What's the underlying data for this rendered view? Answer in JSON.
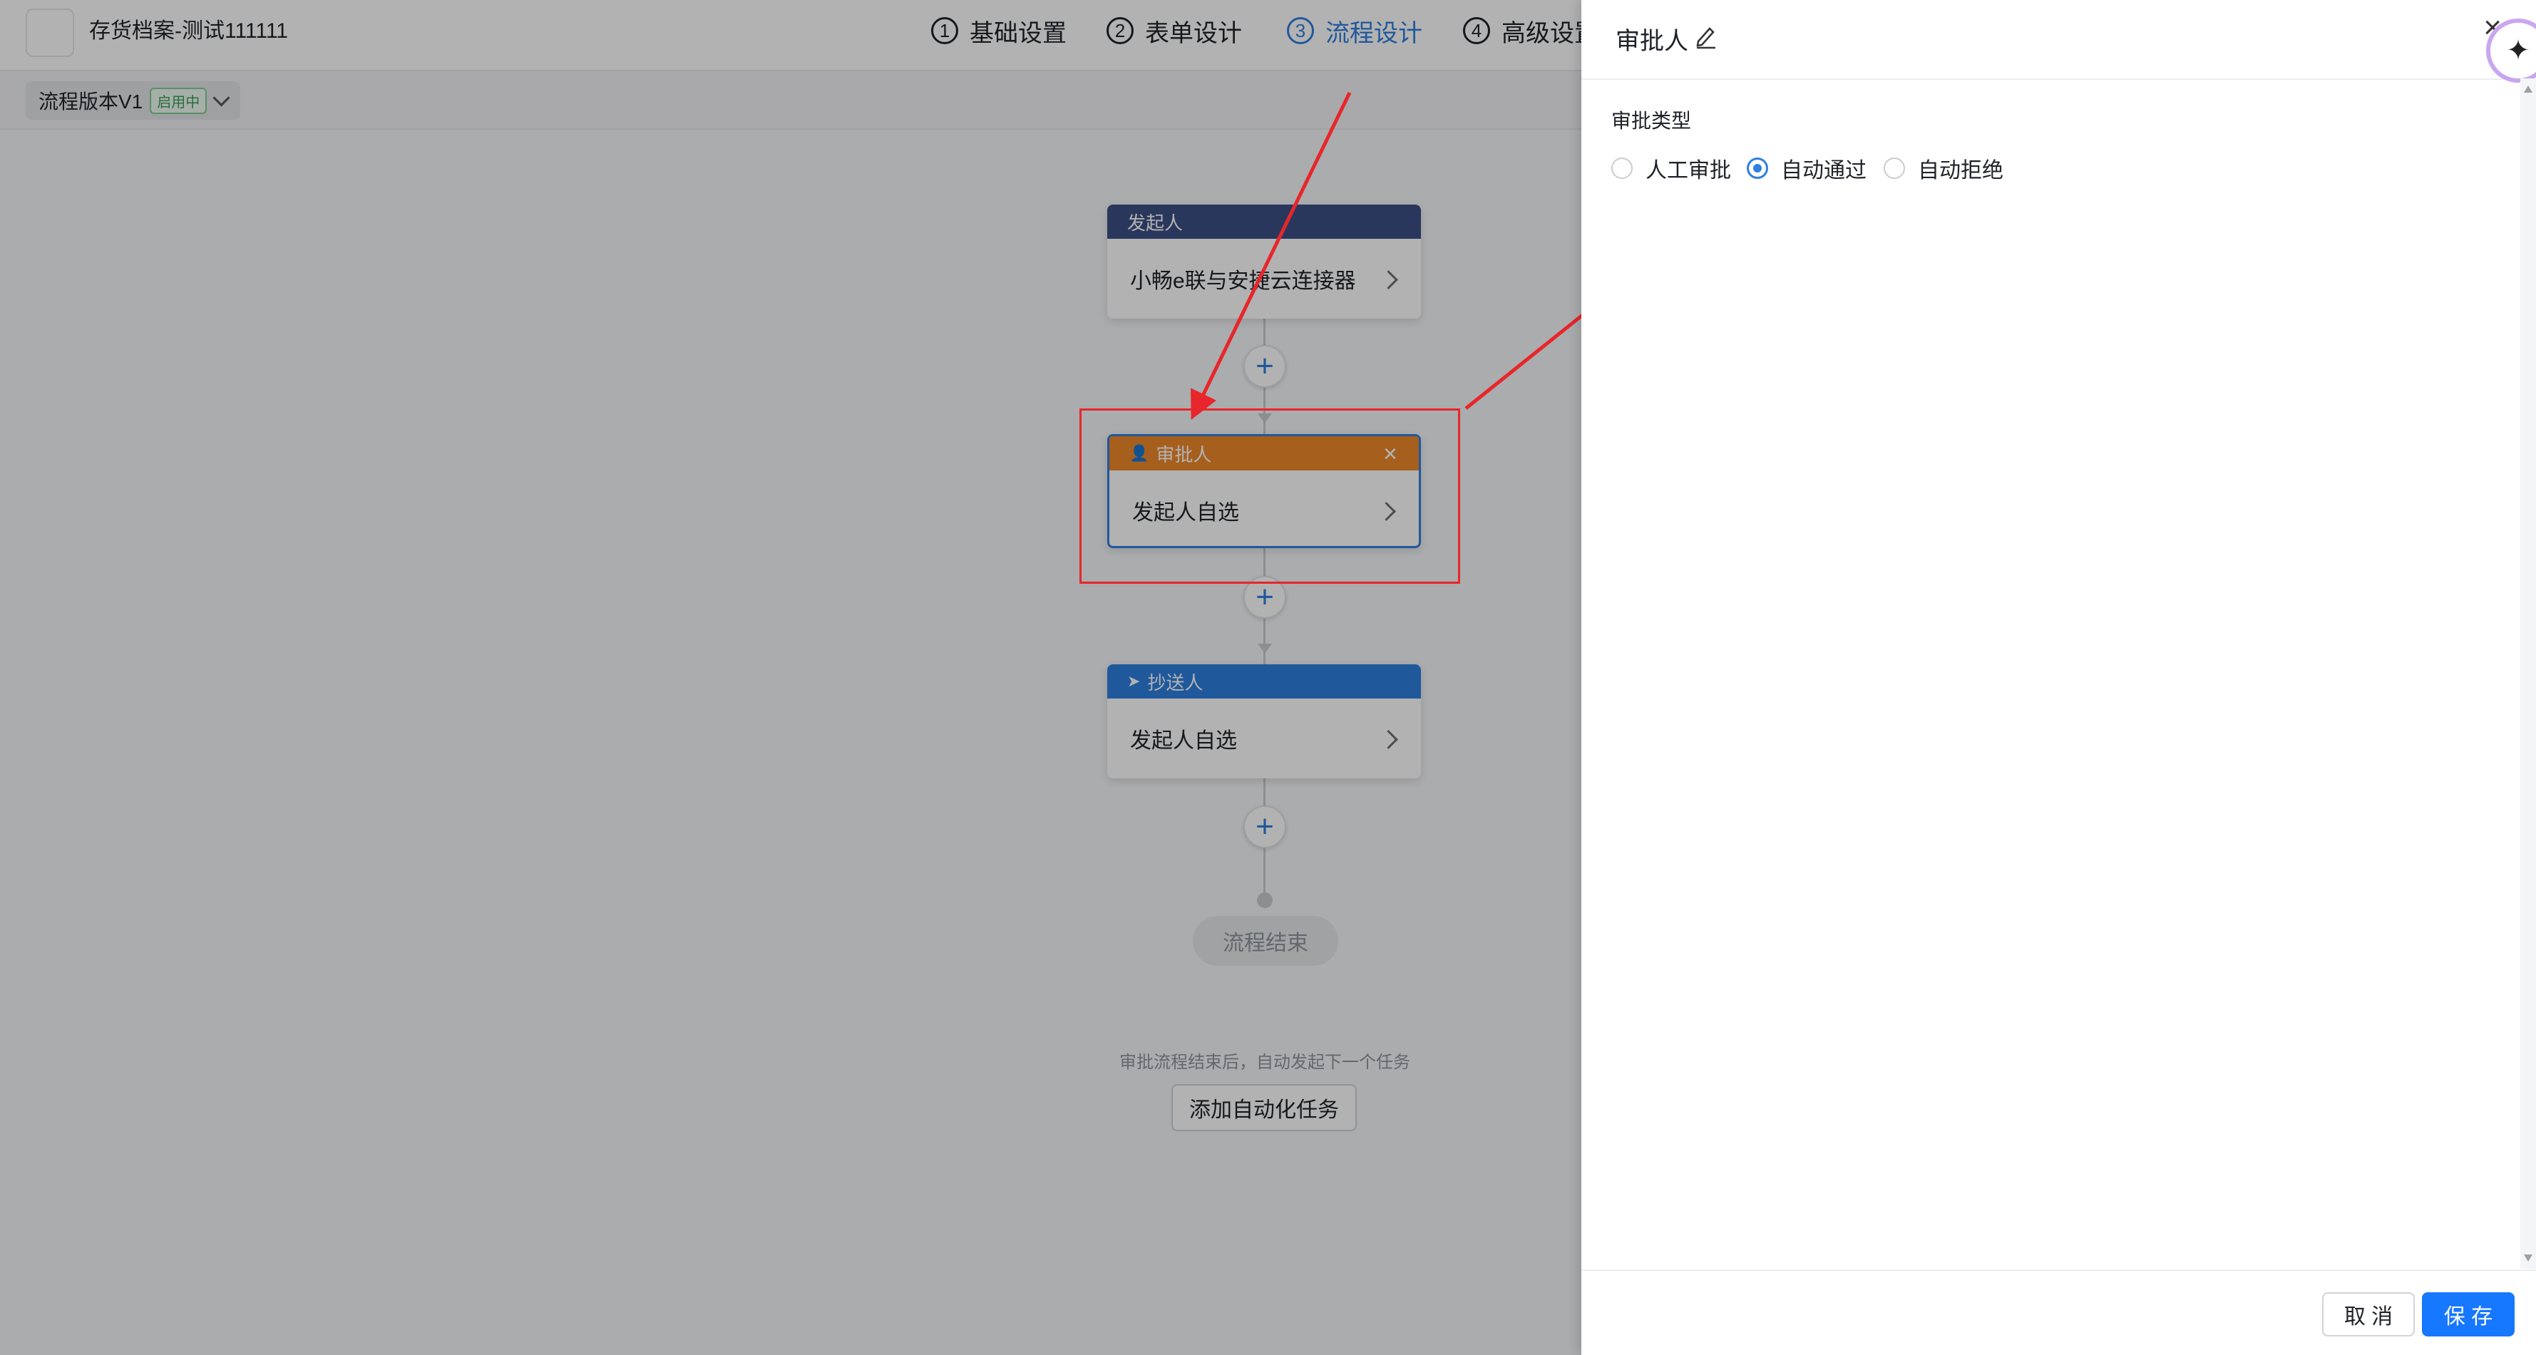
{
  "app": {
    "title": "存货档案-测试111111"
  },
  "steps": [
    {
      "num": "1",
      "label": "基础设置"
    },
    {
      "num": "2",
      "label": "表单设计"
    },
    {
      "num": "3",
      "label": "流程设计"
    },
    {
      "num": "4",
      "label": "高级设置"
    }
  ],
  "version": {
    "label": "流程版本V1",
    "badge": "启用中"
  },
  "flow": {
    "initiator": {
      "title": "发起人",
      "value": "小畅e联与安捷云连接器"
    },
    "approver": {
      "title": "审批人",
      "value": "发起人自选"
    },
    "cc": {
      "title": "抄送人",
      "value": "发起人自选"
    },
    "end_label": "流程结束",
    "auto_hint": "审批流程结束后，自动发起下一个任务",
    "auto_button": "添加自动化任务"
  },
  "drawer": {
    "title": "审批人",
    "field_label": "审批类型",
    "options": [
      {
        "label": "人工审批",
        "checked": false
      },
      {
        "label": "自动通过",
        "checked": true
      },
      {
        "label": "自动拒绝",
        "checked": false
      }
    ],
    "cancel": "取 消",
    "save": "保 存"
  },
  "colors": {
    "primary": "#2f7fe0",
    "initiator_header": "#3c4f86",
    "approver_header": "#f0892c",
    "cc_header": "#2f7fe0",
    "annotation": "#e8262b"
  },
  "icons": {
    "approver": "user-icon",
    "cc": "send-icon",
    "edit": "pencil-icon",
    "close": "close-icon"
  }
}
